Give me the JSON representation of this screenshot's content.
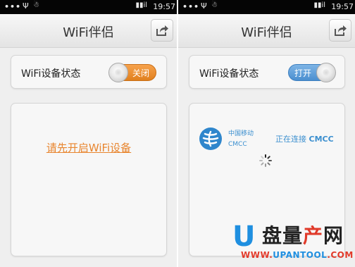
{
  "left_screen": {
    "status_bar": {
      "dots": "•••",
      "usb": "Ψ",
      "bot": "☃",
      "signal": "▮▮il",
      "time": "19:57"
    },
    "title": "WiFi伴侣",
    "wifi_status": {
      "label": "WiFi设备状态",
      "toggle_text": "关闭",
      "toggle_state": "off"
    },
    "prompt": "请先开启WiFi设备"
  },
  "right_screen": {
    "status_bar": {
      "dots": "•••",
      "usb": "Ψ",
      "bot": "☃",
      "signal": "▮▮il",
      "time": "19:57"
    },
    "title": "WiFi伴侣",
    "wifi_status": {
      "label": "WiFi设备状态",
      "toggle_text": "打开",
      "toggle_state": "on"
    },
    "network": {
      "carrier_name": "中国移动",
      "carrier_ssid": "CMCC",
      "connecting_text": "正在连接",
      "connecting_ssid": "CMCC"
    }
  },
  "watermark": {
    "letter": "U",
    "text_part1": "盘量",
    "text_part2": "产",
    "text_part3": "网",
    "url_part1": "WWW.",
    "url_part2": "UPANTOOL",
    "url_part3": ".COM"
  },
  "colors": {
    "accent_orange": "#e8852e",
    "accent_blue": "#3b8fcf",
    "watermark_blue": "#1f8fe0",
    "watermark_red": "#e23a2a"
  },
  "icons": [
    "share-icon",
    "china-mobile-logo-icon",
    "loading-spinner-icon"
  ]
}
